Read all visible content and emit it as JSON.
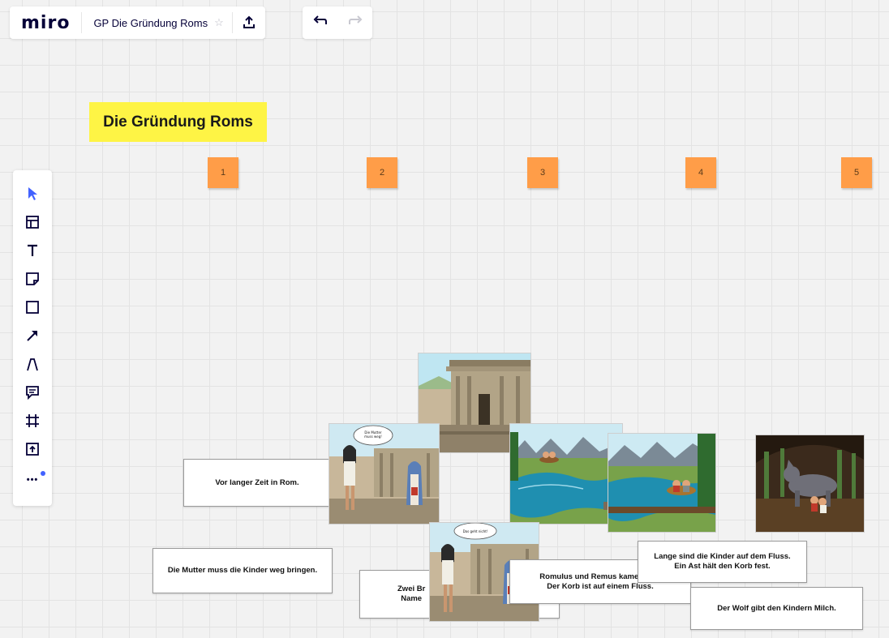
{
  "app": {
    "logo": "miro",
    "board_title": "GP Die Gründung Roms",
    "star": "☆"
  },
  "toolbar": {
    "top_icons": [
      "upload-icon"
    ],
    "undo_icon": "undo-icon",
    "redo_icon": "redo-icon"
  },
  "left_tools": [
    "select-cursor-icon",
    "templates-icon",
    "text-icon",
    "sticky-note-icon",
    "shape-icon",
    "arrow-icon",
    "pen-icon",
    "comment-icon",
    "frame-icon",
    "upload-content-icon",
    "more-icon"
  ],
  "left_more_label": "•••",
  "board": {
    "title": "Die Gründung Roms",
    "numbers": [
      "1",
      "2",
      "3",
      "4",
      "5"
    ],
    "cards": {
      "c1": "Vor langer Zeit in Rom.",
      "c2": "Die Mutter muss die Kinder weg bringen.",
      "c3": "Zwei Br\nName",
      "c4": "Romulus und Remus kamen in ...\nDer Korb ist auf einem Fluss.",
      "c5": "Lange sind die Kinder auf dem Fluss.\nEin Ast hält den Korb fest.",
      "c6": "Der Wolf gibt den Kindern Milch."
    },
    "bubbles": {
      "b1": "Die Mutter\nmuss weg!",
      "b2": "Das geht nicht!"
    }
  },
  "colors": {
    "sticky_yellow": "#fef445",
    "sticky_orange": "#ff9d48",
    "accent": "#4262ff"
  }
}
